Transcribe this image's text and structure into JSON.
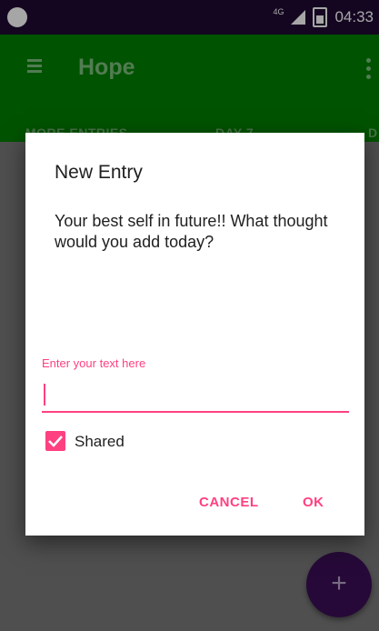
{
  "status_bar": {
    "network": "4G",
    "time": "04:33"
  },
  "app_bar": {
    "title": "Hope"
  },
  "tabs": [
    {
      "label": "MORE ENTRIES"
    },
    {
      "label": "DAY 7"
    },
    {
      "label": "D"
    }
  ],
  "dialog": {
    "title": "New Entry",
    "message": "Your best self in future!! What thought would you add today?",
    "input_label": "Enter your text here",
    "input_value": "",
    "checkbox_label": "Shared",
    "checkbox_checked": true,
    "cancel_label": "CANCEL",
    "ok_label": "OK"
  },
  "fab": {
    "label": "+"
  },
  "colors": {
    "status_bar": "#1f0a33",
    "app_bar": "#008000",
    "accent": "#ff4081",
    "fab": "#3b0f57"
  }
}
